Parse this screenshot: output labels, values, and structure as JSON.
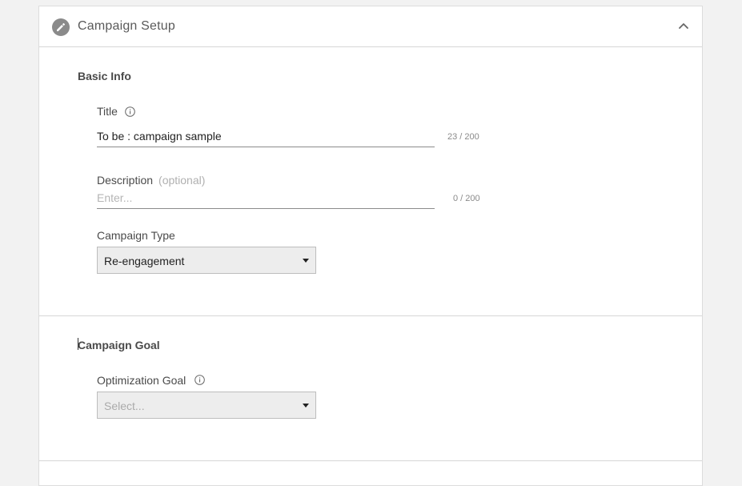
{
  "panel": {
    "title": "Campaign Setup",
    "icon": "pencil-icon",
    "collapse_icon": "chevron-up-icon"
  },
  "basic_info": {
    "section_title": "Basic Info",
    "title_field": {
      "label": "Title",
      "value": "To be : campaign sample",
      "counter": "23 / 200"
    },
    "description_field": {
      "label": "Description",
      "optional": "(optional)",
      "placeholder": "Enter...",
      "counter": "0 / 200"
    },
    "campaign_type": {
      "label": "Campaign Type",
      "selected": "Re-engagement"
    }
  },
  "campaign_goal": {
    "section_title": "Campaign Goal",
    "optimization_goal": {
      "label": "Optimization Goal",
      "placeholder": "Select..."
    }
  }
}
